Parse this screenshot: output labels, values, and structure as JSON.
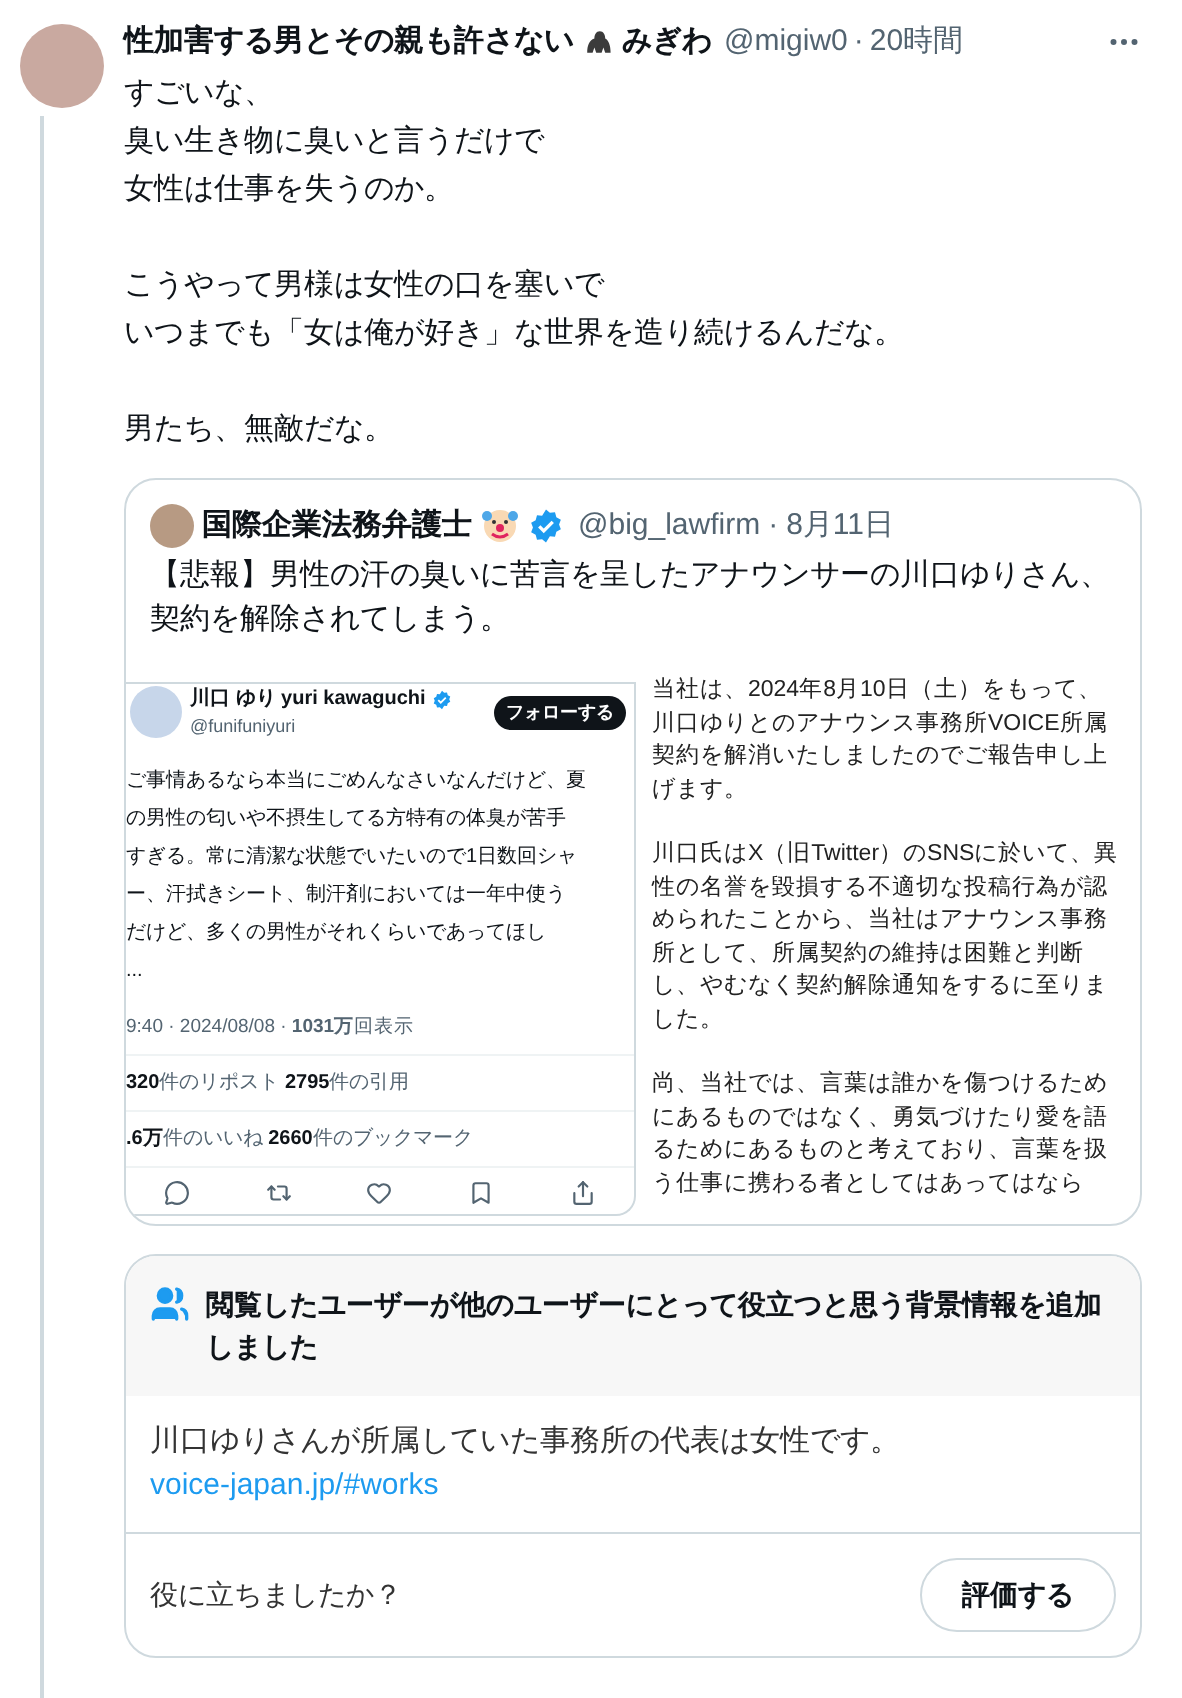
{
  "post": {
    "author": "性加害する男とその親も許さない",
    "author_suffix": "みぎわ",
    "handle": "@migiw0",
    "separator": "·",
    "time": "20時間",
    "paragraphs": [
      [
        "すごいな、",
        "臭い生き物に臭いと言うだけで",
        "女性は仕事を失うのか。"
      ],
      [
        "こうやって男様は女性の口を塞いで",
        "いつまでも「女は俺が好き」な世界を造り続けるんだな。"
      ],
      [
        "男たち、無敵だな。"
      ]
    ]
  },
  "quote": {
    "author": "国際企業法務弁護士",
    "handle": "@big_lawfirm",
    "separator": "·",
    "date": "8月11日",
    "text": "【悲報】男性の汗の臭いに苦言を呈したアナウンサーの川口ゆりさん、契約を解除されてしまう。",
    "image": {
      "tweet": {
        "name": "川口 ゆり yuri kawaguchi",
        "handle": "@funifuniyuri",
        "follow": "フォローする",
        "lines": [
          "ご事情あるなら本当にごめんなさいなんだけど、夏",
          "の男性の匂いや不摂生してる方特有の体臭が苦手",
          "すぎる。常に清潔な状態でいたいので1日数回シャ",
          "ー、汗拭きシート、制汗剤においては一年中使う",
          "だけど、多くの男性がそれくらいであってほし",
          "..."
        ],
        "meta": "9:40 · 2024/08/08 · **1031万**回表示",
        "stats": [
          "**320**件のリポスト **2795**件の引用",
          "**.6万**件のいいね **2660**件のブックマーク"
        ]
      },
      "statement": [
        [
          "当社は、2024年8月10日（土）をもって、",
          "川口ゆりとのアナウンス事務所VOICE所属",
          "契約を解消いたしましたのでご報告申し上",
          "げます。"
        ],
        [
          "川口氏はX（旧Twitter）のSNSに於いて、異",
          "性の名誉を毀損する不適切な投稿行為が認",
          "められたことから、当社はアナウンス事務",
          "所として、所属契約の維持は困難と判断",
          "し、やむなく契約解除通知をするに至りま",
          "した。"
        ],
        [
          "尚、当社では、言葉は誰かを傷つけるため",
          "にあるものではなく、勇気づけたり愛を語",
          "るためにあるものと考えており、言葉を扱",
          "う仕事に携わる者としてはあってはなら"
        ]
      ]
    }
  },
  "note": {
    "title": "閲覧したユーザーが他のユーザーにとって役立つと思う背景情報を追加しました",
    "body": "川口ゆりさんが所属していた事務所の代表は女性です。",
    "link": "voice-japan.jp/#works",
    "question": "役に立ちましたか？",
    "button": "評価する"
  }
}
